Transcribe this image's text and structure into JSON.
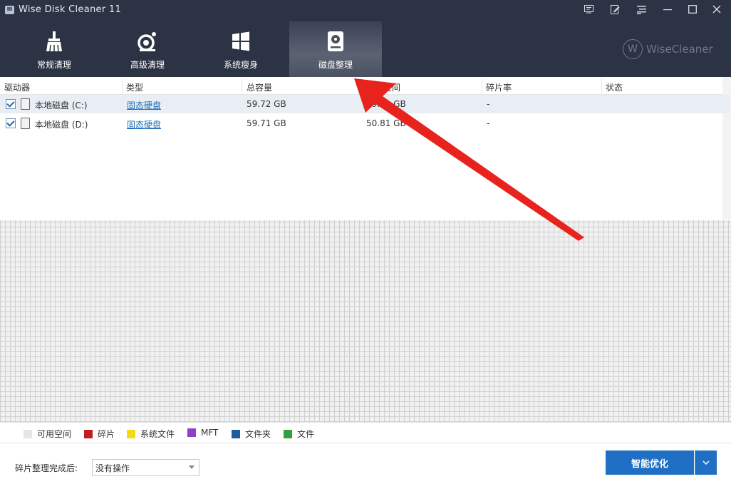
{
  "window": {
    "title": "Wise Disk Cleaner 11",
    "controls": [
      "monitor-icon",
      "edit-icon",
      "menu-icon",
      "minimize-icon",
      "maximize-icon",
      "close-icon"
    ]
  },
  "tabs": [
    {
      "label": "常规清理",
      "icon": "broom-icon"
    },
    {
      "label": "高级清理",
      "icon": "advanced-clean-icon"
    },
    {
      "label": "系统瘦身",
      "icon": "windows-icon"
    },
    {
      "label": "磁盘整理",
      "icon": "disk-defrag-icon",
      "active": true
    }
  ],
  "brand": {
    "logo_letter": "W",
    "name": "WiseCleaner"
  },
  "table": {
    "columns": [
      "驱动器",
      "类型",
      "总容量",
      "可用空间",
      "碎片率",
      "状态"
    ],
    "rows": [
      {
        "checked": true,
        "drive": "本地磁盘 (C:)",
        "type": "固态硬盘",
        "total": "59.72 GB",
        "free": "49.39 GB",
        "frag": "-",
        "status": ""
      },
      {
        "checked": true,
        "drive": "本地磁盘 (D:)",
        "type": "固态硬盘",
        "total": "59.71 GB",
        "free": "50.81 GB",
        "frag": "-",
        "status": ""
      }
    ]
  },
  "legend": [
    {
      "label": "可用空间",
      "color": "#e6e6e6"
    },
    {
      "label": "碎片",
      "color": "#c0201f"
    },
    {
      "label": "系统文件",
      "color": "#f5d816"
    },
    {
      "label": "MFT",
      "color": "#8a3fd1"
    },
    {
      "label": "文件夹",
      "color": "#1d5f9c"
    },
    {
      "label": "文件",
      "color": "#2fa23a"
    }
  ],
  "footer": {
    "after_label": "碎片整理完成后:",
    "after_value": "没有操作",
    "optimize_label": "智能优化"
  },
  "colors": {
    "header_bg": "#2c3344",
    "accent": "#1f6fc4",
    "arrow": "#e8231d"
  }
}
